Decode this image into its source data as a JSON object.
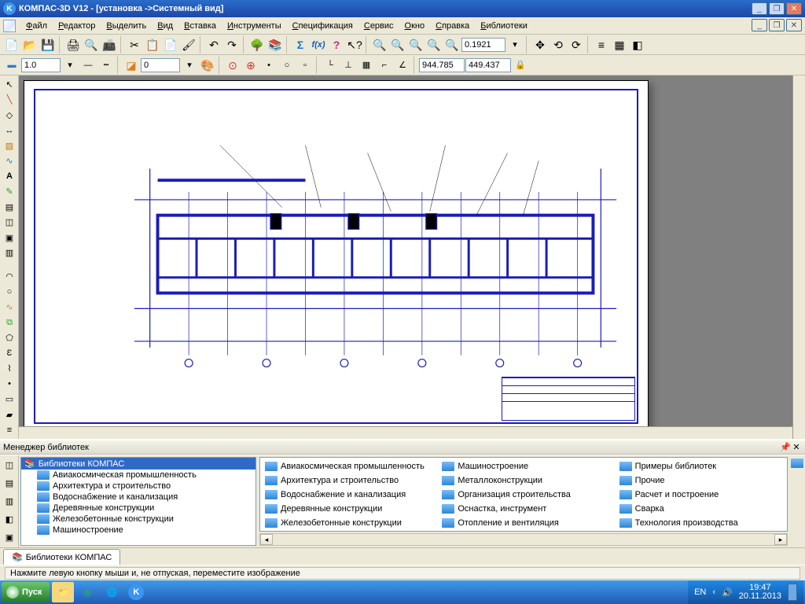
{
  "title": "КОМПАС-3D V12 - [установка ->Системный вид]",
  "menu": [
    "Файл",
    "Редактор",
    "Выделить",
    "Вид",
    "Вставка",
    "Инструменты",
    "Спецификация",
    "Сервис",
    "Окно",
    "Справка",
    "Библиотеки"
  ],
  "zoom_value": "0.1921",
  "line_style": "1.0",
  "offset_value": "0",
  "coord_x": "944.785",
  "coord_y": "449.437",
  "libmgr_title": "Менеджер библиотек",
  "lib_root": "Библиотеки КОМПАС",
  "lib_tree": [
    "Авиакосмическая промышленность",
    "Архитектура и строительство",
    "Водоснабжение и канализация",
    "Деревянные конструкции",
    "Железобетонные конструкции",
    "Машиностроение"
  ],
  "lib_list_col1": [
    "Авиакосмическая промышленность",
    "Архитектура и строительство",
    "Водоснабжение и канализация",
    "Деревянные конструкции",
    "Железобетонные конструкции"
  ],
  "lib_list_col2": [
    "Машиностроение",
    "Металлоконструкции",
    "Организация строительства",
    "Оснастка, инструмент",
    "Отопление и вентиляция"
  ],
  "lib_list_col3": [
    "Примеры библиотек",
    "Прочие",
    "Расчет и построение",
    "Сварка",
    "Технология производства"
  ],
  "tab_label": "Библиотеки КОМПАС",
  "status_text": "Нажмите левую кнопку мыши и, не отпуская, переместите изображение",
  "start_label": "Пуск",
  "lang": "EN",
  "clock_time": "19:47",
  "clock_date": "20.11.2013"
}
